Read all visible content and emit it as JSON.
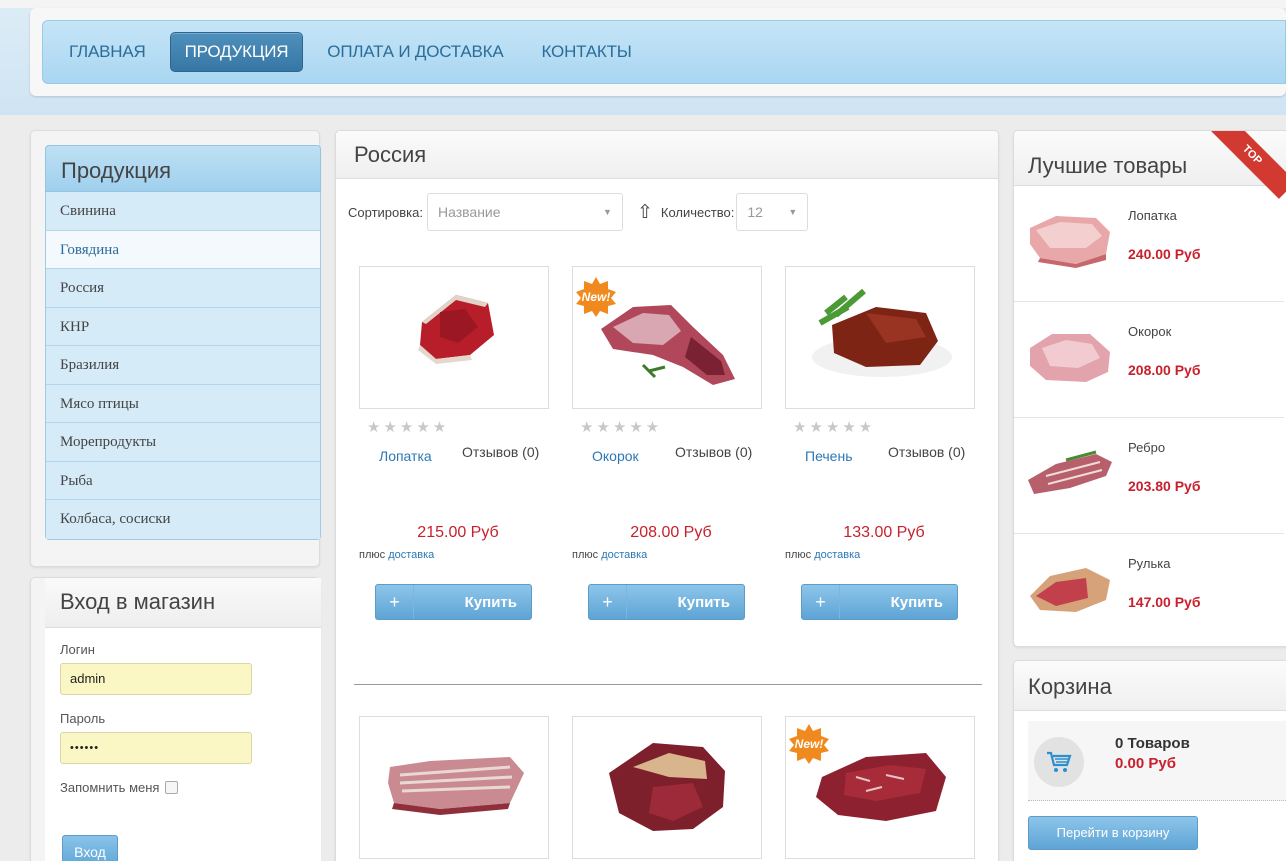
{
  "nav": {
    "items": [
      {
        "label": "ГЛАВНАЯ",
        "active": false
      },
      {
        "label": "ПРОДУКЦИЯ",
        "active": true
      },
      {
        "label": "ОПЛАТА И ДОСТАВКА",
        "active": false
      },
      {
        "label": "КОНТАКТЫ",
        "active": false
      }
    ]
  },
  "categories": {
    "title": "Продукция",
    "items": [
      {
        "label": "Свинина"
      },
      {
        "label": "Говядина"
      },
      {
        "label": "Россия"
      },
      {
        "label": "КНР"
      },
      {
        "label": "Бразилия"
      },
      {
        "label": "Мясо птицы"
      },
      {
        "label": "Морепродукты"
      },
      {
        "label": "Рыба"
      },
      {
        "label": "Колбаса, сосиски"
      }
    ]
  },
  "login": {
    "title": "Вход в магазин",
    "login_label": "Логин",
    "login_value": "admin",
    "password_label": "Пароль",
    "password_value": "••••••",
    "remember_label": "Запомнить меня",
    "button": "Вход"
  },
  "main": {
    "title": "Россия",
    "sort_label": "Сортировка:",
    "sort_value": "Название",
    "count_label": "Количество:",
    "count_value": "12",
    "products": [
      {
        "name": "Лопатка",
        "reviews": "Отзывов (0)",
        "price": "215.00 Руб",
        "plus_text": "плюс",
        "plus_link": "доставка",
        "buy": "Купить",
        "buy_plus": "+",
        "new": false
      },
      {
        "name": "Окорок",
        "reviews": "Отзывов (0)",
        "price": "208.00 Руб",
        "plus_text": "плюс",
        "plus_link": "доставка",
        "buy": "Купить",
        "buy_plus": "+",
        "new": true
      },
      {
        "name": "Печень",
        "reviews": "Отзывов (0)",
        "price": "133.00 Руб",
        "plus_text": "плюс",
        "plus_link": "доставка",
        "buy": "Купить",
        "buy_plus": "+",
        "new": false
      }
    ],
    "new_badge": "New!",
    "stars": "★★★★★"
  },
  "best": {
    "title": "Лучшие товары",
    "flag": "TOP",
    "items": [
      {
        "name": "Лопатка",
        "price": "240.00 Руб"
      },
      {
        "name": "Окорок",
        "price": "208.00 Руб"
      },
      {
        "name": "Ребро",
        "price": "203.80 Руб"
      },
      {
        "name": "Рулька",
        "price": "147.00 Руб"
      }
    ]
  },
  "cart": {
    "title": "Корзина",
    "count": "0 Товаров",
    "total": "0.00 Руб",
    "button": "Перейти в корзину"
  },
  "colors": {
    "accent": "#3777a5",
    "price": "#c8202c",
    "link": "#2b78b5"
  }
}
